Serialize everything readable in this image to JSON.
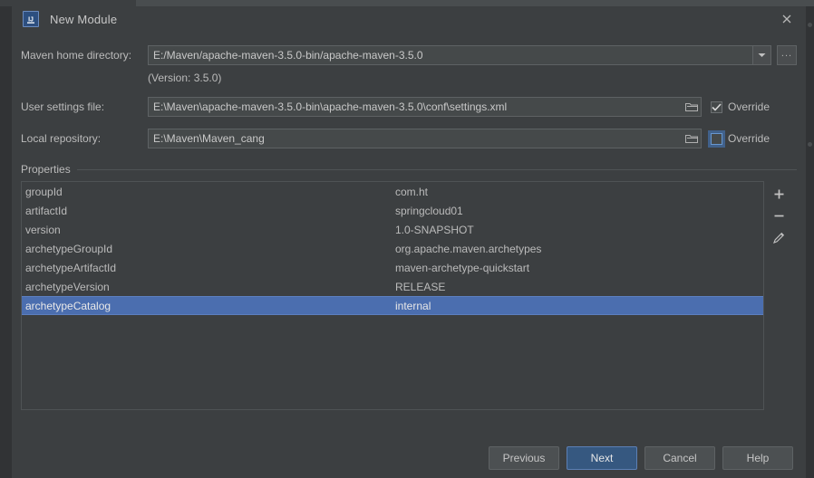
{
  "window": {
    "title": "New Module",
    "app_icon": "intellij-idea-icon",
    "close_icon": "close-icon"
  },
  "form": {
    "maven_home": {
      "label": "Maven home directory:",
      "value": "E:/Maven/apache-maven-3.5.0-bin/apache-maven-3.5.0",
      "dropdown_icon": "chevron-down-icon",
      "browse_label": "...",
      "version_note": "(Version: 3.5.0)"
    },
    "user_settings": {
      "label": "User settings file:",
      "value": "E:\\Maven\\apache-maven-3.5.0-bin\\apache-maven-3.5.0\\conf\\settings.xml",
      "browse_icon": "folder-icon",
      "override_label": "Override",
      "override_checked": true
    },
    "local_repository": {
      "label": "Local repository:",
      "value": "E:\\Maven\\Maven_cang",
      "browse_icon": "folder-icon",
      "override_label": "Override",
      "override_checked": false
    }
  },
  "properties": {
    "group_title": "Properties",
    "rows": [
      {
        "key": "groupId",
        "value": "com.ht",
        "selected": false
      },
      {
        "key": "artifactId",
        "value": "springcloud01",
        "selected": false
      },
      {
        "key": "version",
        "value": "1.0-SNAPSHOT",
        "selected": false
      },
      {
        "key": "archetypeGroupId",
        "value": "org.apache.maven.archetypes",
        "selected": false
      },
      {
        "key": "archetypeArtifactId",
        "value": "maven-archetype-quickstart",
        "selected": false
      },
      {
        "key": "archetypeVersion",
        "value": "RELEASE",
        "selected": false
      },
      {
        "key": "archetypeCatalog",
        "value": "internal",
        "selected": true
      }
    ],
    "tools": [
      {
        "name": "add-property-button",
        "icon": "plus-icon"
      },
      {
        "name": "remove-property-button",
        "icon": "minus-icon"
      },
      {
        "name": "edit-property-button",
        "icon": "pencil-icon"
      }
    ]
  },
  "footer": {
    "previous": "Previous",
    "next": "Next",
    "cancel": "Cancel",
    "help": "Help"
  },
  "colors": {
    "dialog_bg": "#3c3f41",
    "field_bg": "#45494a",
    "selection_blue": "#4b6eaf",
    "default_button_blue": "#365880",
    "focus_ring": "#4a7fc8"
  }
}
